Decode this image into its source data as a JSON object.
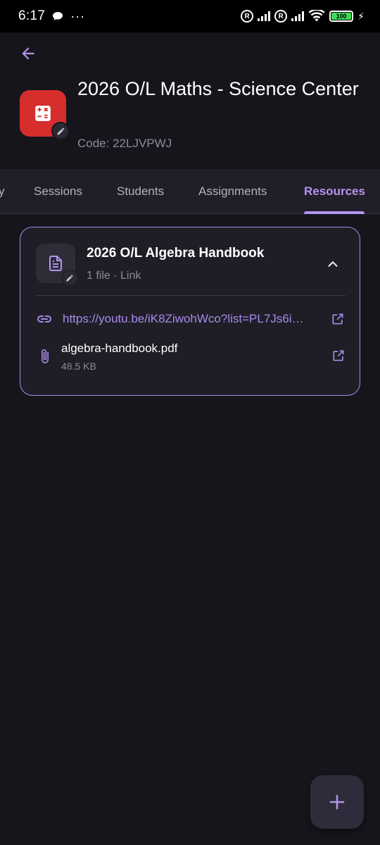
{
  "status_bar": {
    "time": "6:17",
    "dots": "···",
    "battery": "100"
  },
  "header": {
    "title": "2026 O/L Maths - Science Center",
    "code": "Code: 22LJVPWJ",
    "avatar_color": "#d62d2d"
  },
  "tabs": [
    {
      "label": "y",
      "active": false
    },
    {
      "label": "Sessions",
      "active": false
    },
    {
      "label": "Students",
      "active": false
    },
    {
      "label": "Assignments",
      "active": false
    },
    {
      "label": "Resources",
      "active": true
    }
  ],
  "resources": [
    {
      "title": "2026 O/L Algebra Handbook",
      "meta": "1 file · Link",
      "link": "https://youtu.be/iK8ZiwohWco?list=PL7Js6i…",
      "file": {
        "name": "algebra-handbook.pdf",
        "size": "48.5 KB"
      }
    }
  ],
  "colors": {
    "accent": "#b493ee",
    "background": "#16151c",
    "card": "#1f1e27"
  },
  "icons": {
    "back": "arrow-left-icon",
    "fab": "plus-icon"
  }
}
